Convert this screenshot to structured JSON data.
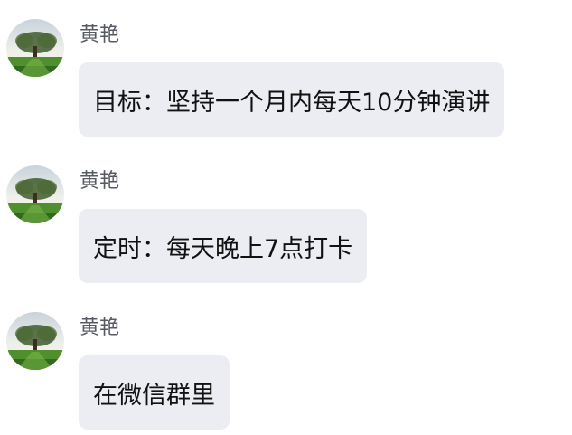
{
  "messages": [
    {
      "sender": "黄艳",
      "avatar_icon": "tree-landscape-avatar",
      "text": "目标：坚持一个月内每天10分钟演讲"
    },
    {
      "sender": "黄艳",
      "avatar_icon": "tree-landscape-avatar",
      "text": "定时：每天晚上7点打卡"
    },
    {
      "sender": "黄艳",
      "avatar_icon": "tree-landscape-avatar",
      "text": "在微信群里"
    }
  ],
  "colors": {
    "bubble_background": "#ebedf2",
    "sender_text": "#555a62",
    "message_text": "#111111"
  }
}
